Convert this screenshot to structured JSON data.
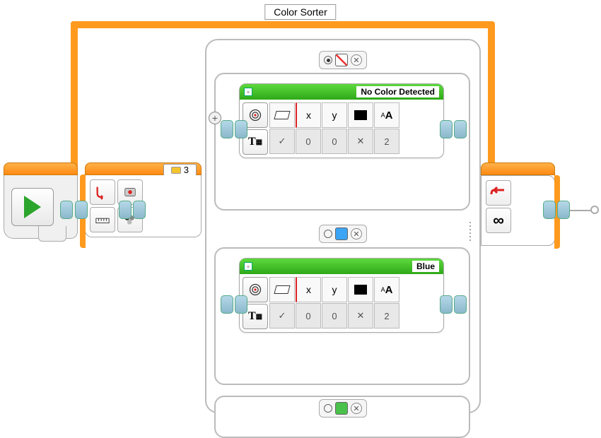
{
  "program_title": "Color Sorter",
  "port_value": "3",
  "switch": {
    "cases": [
      {
        "radio_selected": true,
        "color_name": "No Color",
        "display_title": "No Color Detected",
        "params": {
          "clear_label": "✓",
          "x_label": "x",
          "y_label": "y",
          "font_label": "A",
          "font_small": "A",
          "clear_val": "✓",
          "x_val": "0",
          "y_val": "0",
          "color_val": "✕",
          "font_val": "2"
        }
      },
      {
        "radio_selected": false,
        "color_name": "Blue",
        "display_title": "Blue",
        "params": {
          "clear_val": "✓",
          "x_val": "0",
          "y_val": "0",
          "color_val": "✕",
          "font_val": "2"
        }
      },
      {
        "radio_selected": false,
        "color_name": "Green",
        "display_title": ""
      }
    ]
  },
  "loop_end": {
    "mode": "∞"
  },
  "icons": {
    "close": "✕",
    "check": "✓",
    "plus": "+"
  }
}
